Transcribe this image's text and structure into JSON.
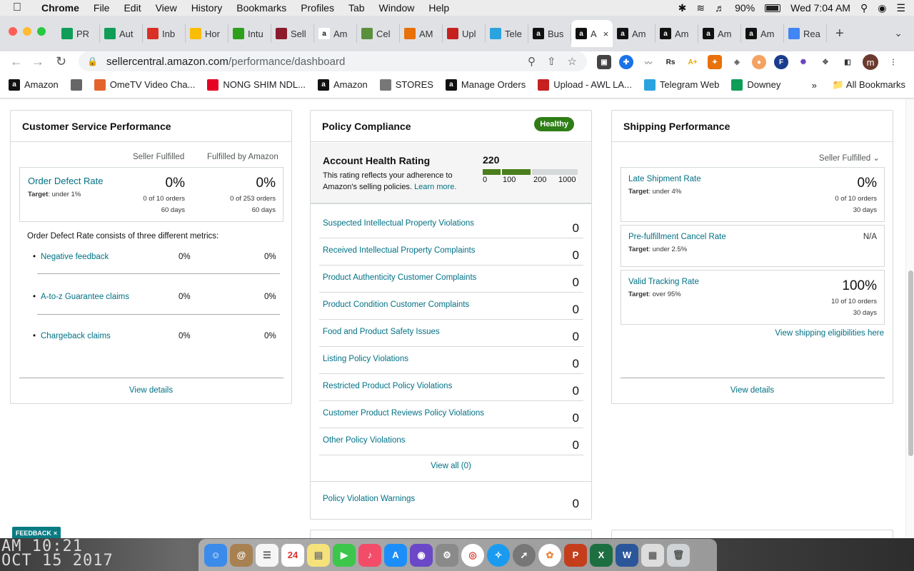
{
  "menubar": {
    "app": "Chrome",
    "items": [
      "File",
      "Edit",
      "View",
      "History",
      "Bookmarks",
      "Profiles",
      "Tab",
      "Window",
      "Help"
    ],
    "battery": "90%",
    "clock": "Wed 7:04 AM"
  },
  "tabs": [
    {
      "title": "PR",
      "icon": "sheets-icon",
      "color": "#0f9d58"
    },
    {
      "title": "Aut",
      "icon": "sheets-icon",
      "color": "#0f9d58"
    },
    {
      "title": "Inb",
      "icon": "gmail-icon",
      "color": "#d93025"
    },
    {
      "title": "Hor",
      "icon": "drive-icon",
      "color": "#fbbc04"
    },
    {
      "title": "Intu",
      "icon": "quickbooks-icon",
      "color": "#2ca01c"
    },
    {
      "title": "Sell",
      "icon": "sn-icon",
      "color": "#8b1a2b"
    },
    {
      "title": "Am",
      "icon": "amazon-icon",
      "color": "#ffffff"
    },
    {
      "title": "Cel",
      "icon": "leaf-icon",
      "color": "#5a8f3c"
    },
    {
      "title": "AM",
      "icon": "edit-icon",
      "color": "#e8710a"
    },
    {
      "title": "Upl",
      "icon": "awl-icon",
      "color": "#c5221f"
    },
    {
      "title": "Tele",
      "icon": "telegram-icon",
      "color": "#2aa3df"
    },
    {
      "title": "Bus",
      "icon": "amazon-icon",
      "color": "#111111"
    },
    {
      "title": "A",
      "icon": "amazon-icon",
      "color": "#111111",
      "active": true
    },
    {
      "title": "Am",
      "icon": "amazon-icon",
      "color": "#111111"
    },
    {
      "title": "Am",
      "icon": "amazon-icon",
      "color": "#111111"
    },
    {
      "title": "Am",
      "icon": "amazon-icon",
      "color": "#111111"
    },
    {
      "title": "Am",
      "icon": "amazon-icon",
      "color": "#111111"
    },
    {
      "title": "Rea",
      "icon": "google-icon",
      "color": "#4285f4"
    }
  ],
  "address": {
    "domain": "sellercentral.amazon.com",
    "path": "/performance/dashboard"
  },
  "profile_initial": "m",
  "bookmarks": [
    {
      "label": "Amazon",
      "icon": "amazon-icon"
    },
    {
      "label": "",
      "icon": "globe-icon"
    },
    {
      "label": "OmeTV Video Cha...",
      "icon": "ometv-icon"
    },
    {
      "label": "NONG SHIM NDL...",
      "icon": "pinterest-icon"
    },
    {
      "label": "Amazon",
      "icon": "amazon-icon"
    },
    {
      "label": "STORES",
      "icon": "folder-icon"
    },
    {
      "label": "Manage Orders",
      "icon": "amazon-icon"
    },
    {
      "label": "Upload - AWL LA...",
      "icon": "awl-icon"
    },
    {
      "label": "Telegram Web",
      "icon": "telegram-icon"
    },
    {
      "label": "Downey",
      "icon": "sheets-icon"
    }
  ],
  "bookmarks_right": {
    "more": "»",
    "all": "All Bookmarks"
  },
  "customer_service": {
    "title": "Customer Service Performance",
    "col1": "Seller Fulfilled",
    "col2": "Fulfilled by Amazon",
    "odr_label": "Order Defect Rate",
    "odr_target_label": "Target",
    "odr_target_value": ": under 1%",
    "sf_pct": "0%",
    "sf_orders": "0 of 10 orders",
    "sf_days": "60 days",
    "fba_pct": "0%",
    "fba_orders": "0 of 253 orders",
    "fba_days": "60 days",
    "desc": "Order Defect Rate consists of three different metrics:",
    "metrics": [
      {
        "name": "Negative feedback",
        "sf": "0%",
        "fba": "0%"
      },
      {
        "name": "A-to-z Guarantee claims",
        "sf": "0%",
        "fba": "0%"
      },
      {
        "name": "Chargeback claims",
        "sf": "0%",
        "fba": "0%"
      }
    ],
    "view_details": "View details"
  },
  "policy": {
    "title": "Policy Compliance",
    "badge": "Healthy",
    "ahr_title": "Account Health Rating",
    "ahr_desc": "This rating reflects your adherence to Amazon's selling policies.",
    "learn_more": "Learn more.",
    "score": "220",
    "ticks": [
      "0",
      "100",
      "200",
      "1000"
    ],
    "violations": [
      {
        "name": "Suspected Intellectual Property Violations",
        "count": "0"
      },
      {
        "name": "Received Intellectual Property Complaints",
        "count": "0"
      },
      {
        "name": "Product Authenticity Customer Complaints",
        "count": "0"
      },
      {
        "name": "Product Condition Customer Complaints",
        "count": "0"
      },
      {
        "name": "Food and Product Safety Issues",
        "count": "0"
      },
      {
        "name": "Listing Policy Violations",
        "count": "0"
      },
      {
        "name": "Restricted Product Policy Violations",
        "count": "0"
      },
      {
        "name": "Customer Product Reviews Policy Violations",
        "count": "0"
      },
      {
        "name": "Other Policy Violations",
        "count": "0"
      }
    ],
    "view_all": "View all (0)",
    "warnings": {
      "name": "Policy Violation Warnings",
      "count": "0"
    }
  },
  "shipping": {
    "title": "Shipping Performance",
    "filter": "Seller Fulfilled",
    "late": {
      "name": "Late Shipment Rate",
      "target_label": "Target",
      "target": ": under 4%",
      "pct": "0%",
      "orders": "0 of 10 orders",
      "days": "30 days"
    },
    "cancel": {
      "name": "Pre-fulfillment Cancel Rate",
      "target_label": "Target",
      "target": ": under 2.5%",
      "value": "N/A"
    },
    "tracking": {
      "name": "Valid Tracking Rate",
      "target_label": "Target",
      "target": ": over 95%",
      "pct": "100%",
      "orders": "10 of 10 orders",
      "days": "30 days"
    },
    "eligibility": "View shipping eligibilities here",
    "view_details": "View details"
  },
  "feedback": "FEEDBACK",
  "wallpaper": {
    "line1": "AM 10:21",
    "line2": "OCT 15 2017"
  },
  "colors": {
    "link": "#007185",
    "healthy": "#2e7d16",
    "bar_green": "#4b7e1c",
    "bar_gray": "#d5d9d9"
  }
}
